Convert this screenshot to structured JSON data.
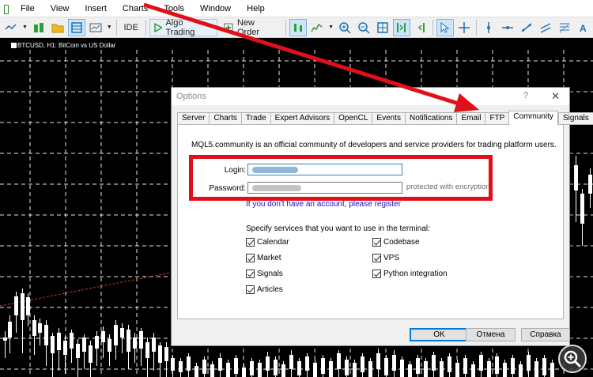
{
  "menu": {
    "items": [
      "File",
      "View",
      "Insert",
      "Charts",
      "Tools",
      "Window",
      "Help"
    ]
  },
  "toolbar": {
    "ide_label": "IDE",
    "algo_label": "Algo Trading",
    "new_order_label": "New Order"
  },
  "chart": {
    "title": "BTCUSD, H1: BitCoin vs US Dollar",
    "colors": {
      "background": "#000000",
      "grid": "#ffffff",
      "candle": "#ffffff",
      "level_line": "#c0392b"
    }
  },
  "dialog": {
    "title": "Options",
    "help_glyph": "?",
    "close_glyph": "✕",
    "tabs": [
      "Server",
      "Charts",
      "Trade",
      "Expert Advisors",
      "OpenCL",
      "Events",
      "Notifications",
      "Email",
      "FTP",
      "Community",
      "Signals"
    ],
    "active_tab": "Community",
    "intro": "MQL5.community is an official community of developers and service providers for trading platform users.",
    "login_label": "Login:",
    "password_label": "Password:",
    "protected_note": "protected with encryption",
    "register_link": "If you don't have an account, please register",
    "specify_text": "Specify services that you want to use in the terminal:",
    "services_left": [
      "Calendar",
      "Market",
      "Signals",
      "Articles"
    ],
    "services_right": [
      "Codebase",
      "VPS",
      "Python integration"
    ],
    "buttons": {
      "ok": "OK",
      "cancel": "Отмена",
      "help": "Справка"
    }
  },
  "annotation": {
    "highlight_color": "#e0101b",
    "arrow_color": "#e0101b"
  }
}
